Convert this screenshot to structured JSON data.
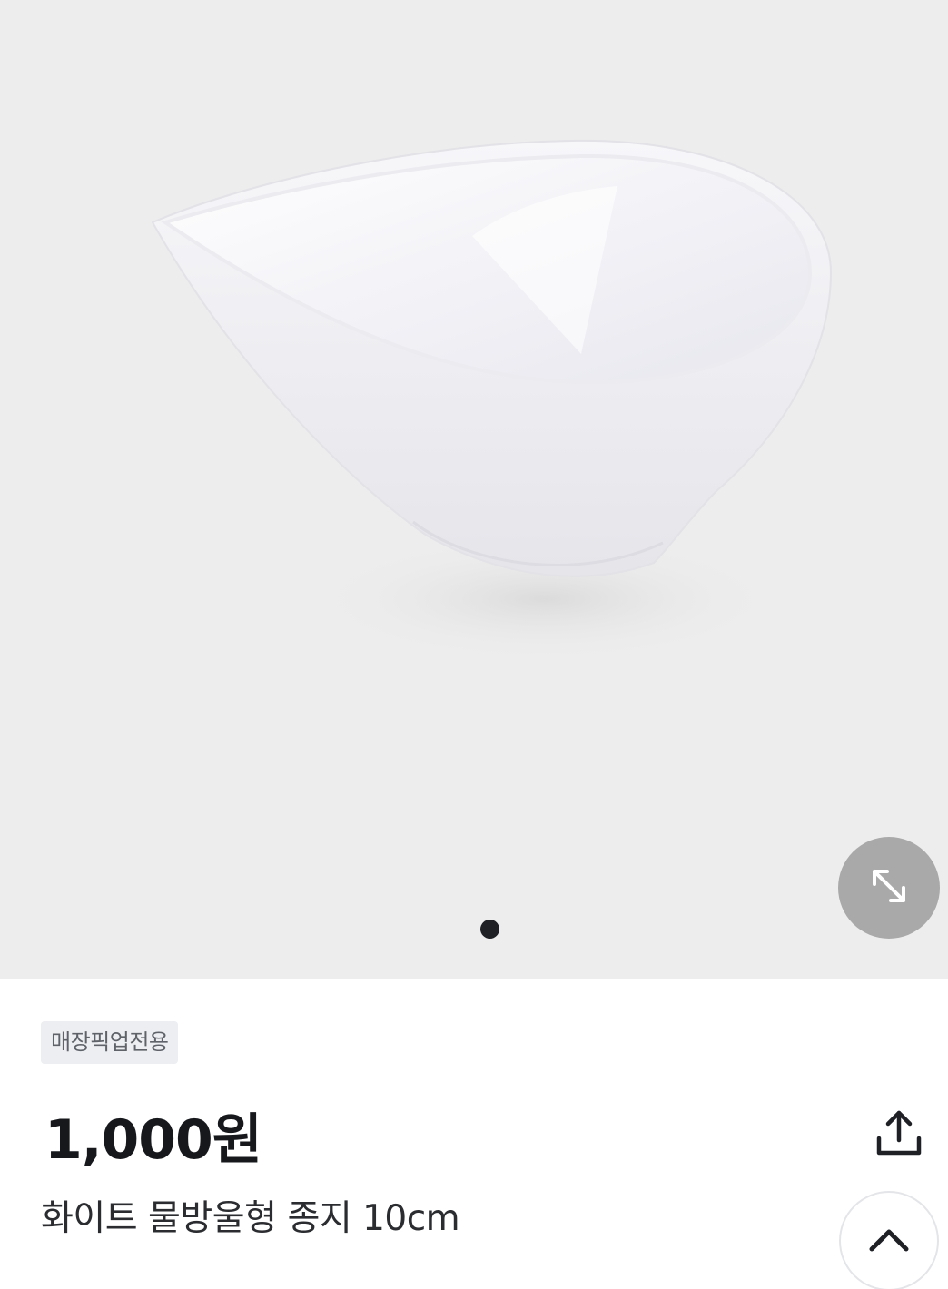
{
  "product": {
    "badge": "매장픽업전용",
    "price": "1,000원",
    "title": "화이트 물방울형 종지 10cm"
  },
  "gallery": {
    "image_count": 1,
    "current_index": 0
  },
  "icons": {
    "expand": "expand-arrows-icon",
    "share": "share-upload-icon",
    "scroll_top": "chevron-up-icon"
  },
  "colors": {
    "hero_background": "#ededed",
    "badge_background": "#eceef1",
    "badge_text": "#5f6369",
    "price_text": "#16181c",
    "expand_button": "#a9a9a9",
    "pager_dot_active": "#1e2026"
  }
}
